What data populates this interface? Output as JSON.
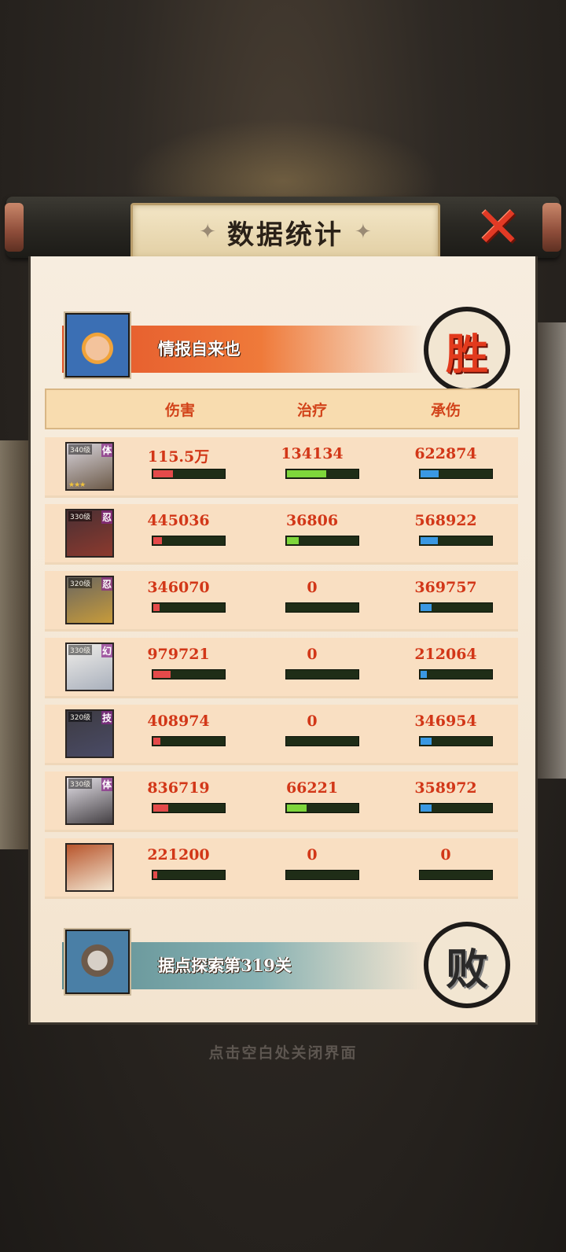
{
  "dialog": {
    "title": "数据统计",
    "close_icon": "close-x-icon"
  },
  "winner": {
    "name": "情报自来也",
    "result_seal": "胜"
  },
  "loser": {
    "name": "据点探索第319关",
    "result_seal": "败"
  },
  "columns": [
    "伤害",
    "治疗",
    "承伤"
  ],
  "rows": [
    {
      "rank": "340级",
      "tag": "体",
      "stars": "★★★",
      "portrait_colors": [
        "#d8d4dc",
        "#6c5a48"
      ],
      "damage": "115.5万",
      "damage_bar": 0.28,
      "heal": "134134",
      "heal_bar": 0.55,
      "taken": "622874",
      "taken_bar": 0.26
    },
    {
      "rank": "330级",
      "tag": "忍",
      "stars": "",
      "portrait_colors": [
        "#4a2f33",
        "#8c3a2e"
      ],
      "damage": "445036",
      "damage_bar": 0.12,
      "heal": "36806",
      "heal_bar": 0.17,
      "taken": "568922",
      "taken_bar": 0.24
    },
    {
      "rank": "320级",
      "tag": "忍",
      "stars": "",
      "portrait_colors": [
        "#6a6660",
        "#c79b3a"
      ],
      "damage": "346070",
      "damage_bar": 0.09,
      "heal": "0",
      "heal_bar": 0,
      "taken": "369757",
      "taken_bar": 0.16
    },
    {
      "rank": "330级",
      "tag": "幻",
      "stars": "",
      "portrait_colors": [
        "#f0eeea",
        "#a9b0bc"
      ],
      "damage": "979721",
      "damage_bar": 0.24,
      "heal": "0",
      "heal_bar": 0,
      "taken": "212064",
      "taken_bar": 0.09
    },
    {
      "rank": "320级",
      "tag": "技",
      "stars": "",
      "portrait_colors": [
        "#3d3b42",
        "#4a4b66"
      ],
      "damage": "408974",
      "damage_bar": 0.1,
      "heal": "0",
      "heal_bar": 0,
      "taken": "346954",
      "taken_bar": 0.15
    },
    {
      "rank": "330级",
      "tag": "体",
      "stars": "",
      "portrait_colors": [
        "#e6e2e9",
        "#444044"
      ],
      "damage": "836719",
      "damage_bar": 0.21,
      "heal": "66221",
      "heal_bar": 0.28,
      "taken": "358972",
      "taken_bar": 0.15
    },
    {
      "rank": "",
      "tag": "",
      "stars": "",
      "portrait_colors": [
        "#b8552c",
        "#f2e5d0"
      ],
      "damage": "221200",
      "damage_bar": 0.06,
      "heal": "0",
      "heal_bar": 0,
      "taken": "0",
      "taken_bar": 0
    }
  ],
  "footer_hint": "点击空白处关闭界面"
}
